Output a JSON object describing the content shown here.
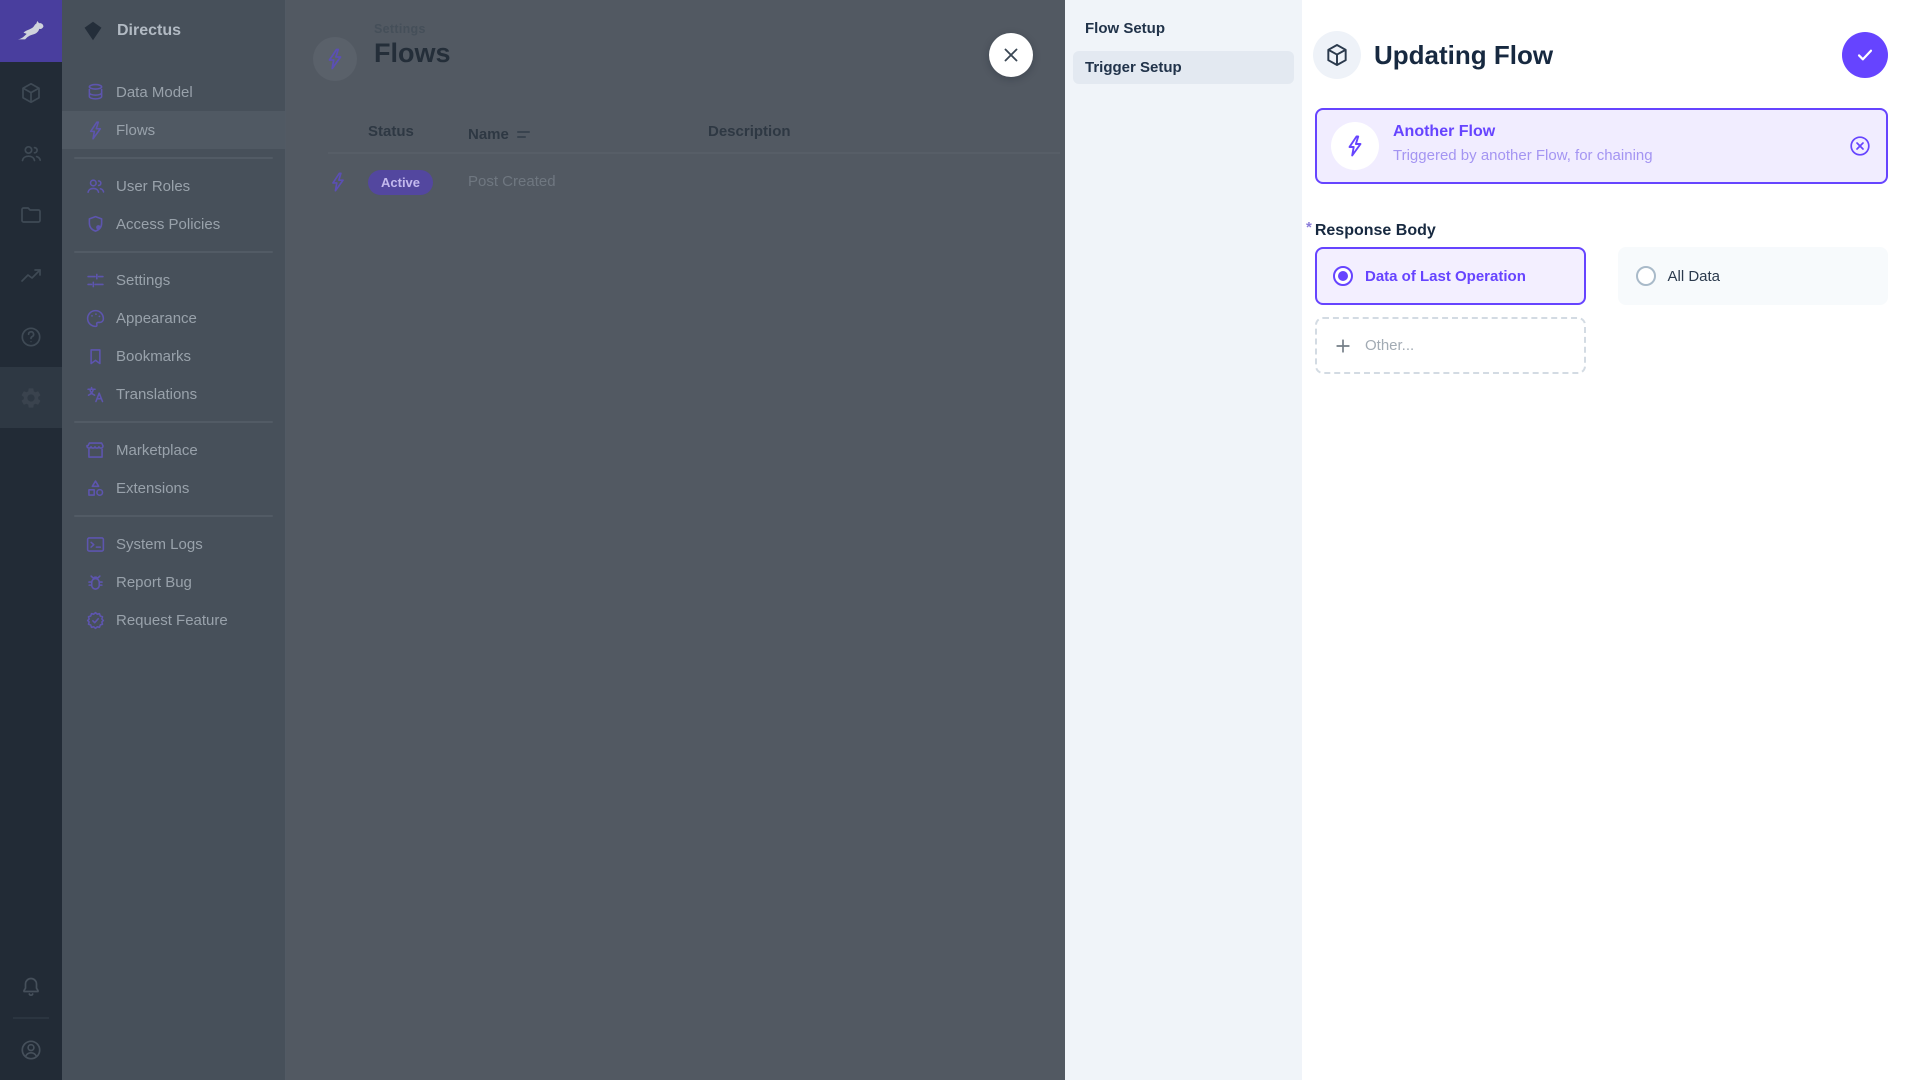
{
  "brand": {
    "name": "Directus"
  },
  "module_bar": {
    "modules": [
      {
        "id": "content",
        "icon": "cube-icon"
      },
      {
        "id": "users",
        "icon": "users-icon"
      },
      {
        "id": "files",
        "icon": "folder-icon"
      },
      {
        "id": "insights",
        "icon": "chart-icon"
      },
      {
        "id": "help",
        "icon": "help-icon"
      },
      {
        "id": "settings",
        "icon": "gear-icon",
        "active": true
      }
    ],
    "bottom_icons": [
      "bell-icon",
      "avatar-icon"
    ]
  },
  "sidebar": {
    "project_name": "Directus",
    "groups": [
      {
        "items": [
          {
            "label": "Data Model"
          },
          {
            "label": "Flows",
            "active": true
          }
        ]
      },
      {
        "items": [
          {
            "label": "User Roles"
          },
          {
            "label": "Access Policies"
          }
        ]
      },
      {
        "items": [
          {
            "label": "Settings"
          },
          {
            "label": "Appearance"
          },
          {
            "label": "Bookmarks"
          },
          {
            "label": "Translations"
          }
        ]
      },
      {
        "items": [
          {
            "label": "Marketplace"
          },
          {
            "label": "Extensions"
          }
        ]
      },
      {
        "items": [
          {
            "label": "System Logs"
          },
          {
            "label": "Report Bug"
          },
          {
            "label": "Request Feature"
          }
        ]
      }
    ]
  },
  "content": {
    "breadcrumb": "Settings",
    "title": "Flows",
    "table": {
      "columns": [
        "Status",
        "Name",
        "Description"
      ],
      "rows": [
        {
          "status": "Active",
          "name": "Post Created",
          "description": ""
        }
      ]
    }
  },
  "drawer": {
    "nav": [
      {
        "label": "Flow Setup",
        "active": false
      },
      {
        "label": "Trigger Setup",
        "active": true
      }
    ],
    "title": "Updating Flow",
    "trigger_card": {
      "title": "Another Flow",
      "subtitle": "Triggered by another Flow, for chaining"
    },
    "response_body": {
      "label": "Response Body",
      "required_marker": "*",
      "options": [
        {
          "label": "Data of Last Operation",
          "selected": true
        },
        {
          "label": "All Data",
          "selected": false
        }
      ],
      "other_label": "Other..."
    }
  },
  "colors": {
    "primary": "#6644ff",
    "navy": "#172940"
  }
}
